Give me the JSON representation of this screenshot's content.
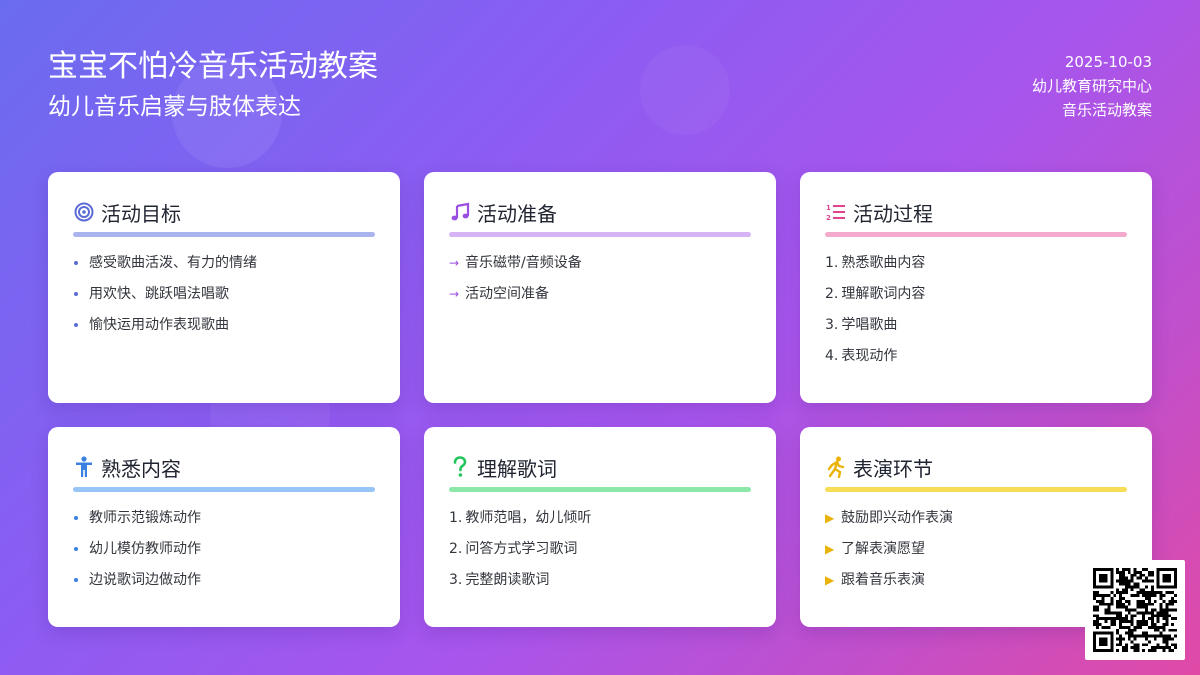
{
  "header": {
    "title": "宝宝不怕冷音乐活动教案",
    "subtitle": "幼儿音乐启蒙与肢体表达",
    "date": "2025-10-03",
    "organization": "幼儿教育研究中心",
    "doc_type": "音乐活动教案"
  },
  "cards": [
    {
      "title": "活动目标",
      "icon": "target-icon",
      "accent": "#5b6cd6",
      "bar": "#a9b4ee",
      "marker": "dot",
      "items": [
        "感受歌曲活泼、有力的情绪",
        "用欢快、跳跃唱法唱歌",
        "愉快运用动作表现歌曲"
      ]
    },
    {
      "title": "活动准备",
      "icon": "music-note-icon",
      "accent": "#9b4fe0",
      "bar": "#d6b4f6",
      "marker": "→",
      "items": [
        "音乐磁带/音频设备",
        "活动空间准备"
      ]
    },
    {
      "title": "活动过程",
      "icon": "numbered-list-icon",
      "accent": "#e0448f",
      "bar": "#f4aacc",
      "marker": "number",
      "items": [
        "熟悉歌曲内容",
        "理解歌词内容",
        "学唱歌曲",
        "表现动作"
      ]
    },
    {
      "title": "熟悉内容",
      "icon": "child-icon",
      "accent": "#3b82e0",
      "bar": "#96c4f6",
      "marker": "dot",
      "items": [
        "教师示范锻炼动作",
        "幼儿模仿教师动作",
        "边说歌词边做动作"
      ]
    },
    {
      "title": "理解歌词",
      "icon": "question-icon",
      "accent": "#22c55e",
      "bar": "#8be8a8",
      "marker": "number",
      "items": [
        "教师范唱，幼儿倾听",
        "问答方式学习歌词",
        "完整朗读歌词"
      ]
    },
    {
      "title": "表演环节",
      "icon": "running-person-icon",
      "accent": "#eab308",
      "bar": "#f7dc55",
      "marker": "▶",
      "items": [
        "鼓励即兴动作表演",
        "了解表演愿望",
        "跟着音乐表演"
      ]
    }
  ]
}
